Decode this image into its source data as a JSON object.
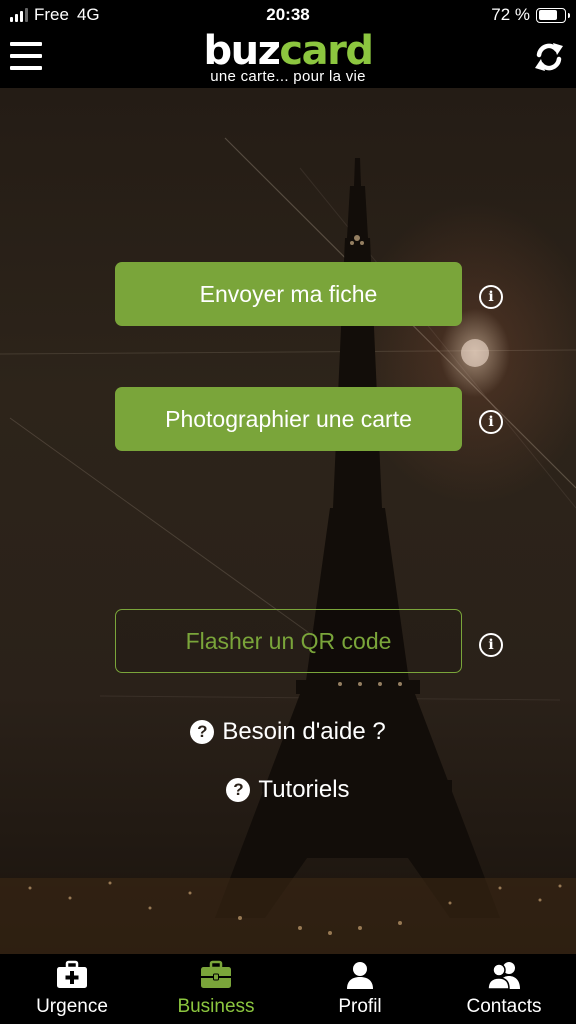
{
  "status_bar": {
    "carrier": "Free",
    "network": "4G",
    "time": "20:38",
    "battery_text": "72 %",
    "battery_level": 0.72
  },
  "header": {
    "logo_part1": "buz",
    "logo_part2": "card",
    "tagline": "une carte... pour la vie",
    "menu_icon": "hamburger-menu-icon",
    "refresh_icon": "refresh-icon"
  },
  "actions": {
    "send_card": "Envoyer ma fiche",
    "photograph_card": "Photographier une carte",
    "scan_qr": "Flasher un QR code",
    "info_glyph": "i"
  },
  "help": {
    "need_help": "Besoin d'aide ?",
    "tutorials": "Tutoriels",
    "question_glyph": "?"
  },
  "tabs": [
    {
      "label": "Urgence",
      "icon": "first-aid-kit-icon",
      "active": false
    },
    {
      "label": "Business",
      "icon": "briefcase-icon",
      "active": true
    },
    {
      "label": "Profil",
      "icon": "person-icon",
      "active": false
    },
    {
      "label": "Contacts",
      "icon": "people-icon",
      "active": false
    }
  ],
  "colors": {
    "accent_green": "#7aa53a",
    "logo_green": "#8cc63f",
    "background": "#000000"
  }
}
